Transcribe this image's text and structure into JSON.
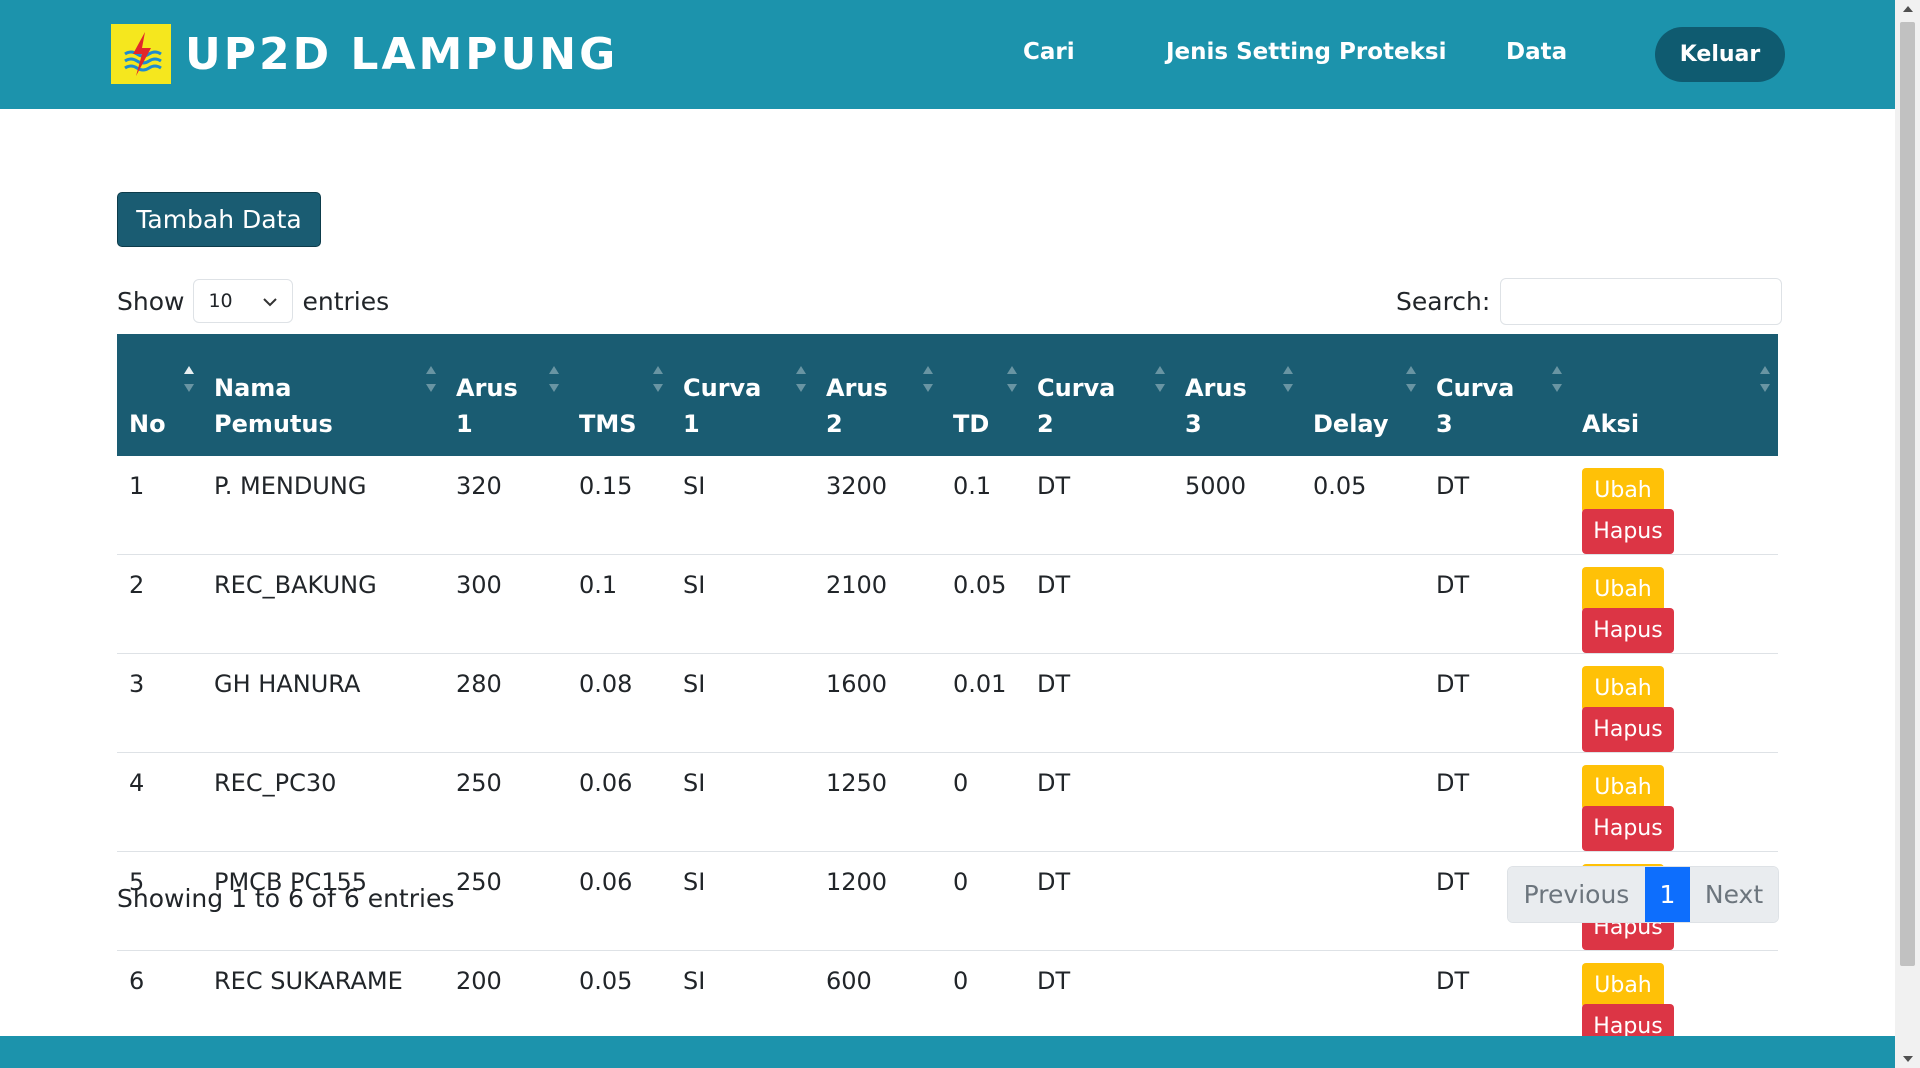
{
  "brand": {
    "name": "UP2D LAMPUNG",
    "logo_icon": "pln-logo-icon"
  },
  "nav": {
    "cari": "Cari",
    "jenis": "Jenis Setting Proteksi",
    "data": "Data",
    "logout": "Keluar"
  },
  "actions": {
    "add": "Tambah Data"
  },
  "length": {
    "show": "Show",
    "value": "10",
    "entries": "entries"
  },
  "search": {
    "label": "Search:",
    "value": ""
  },
  "table": {
    "headers": [
      [
        "No",
        ""
      ],
      [
        "Nama",
        "Pemutus"
      ],
      [
        "Arus",
        "1"
      ],
      [
        "",
        "TMS"
      ],
      [
        "",
        "Curva 1"
      ],
      [
        "Arus",
        "2"
      ],
      [
        "",
        "TD"
      ],
      [
        "Curva",
        "2"
      ],
      [
        "Arus",
        "3"
      ],
      [
        "",
        "Delay"
      ],
      [
        "Curva",
        "3"
      ],
      [
        "",
        "Aksi"
      ]
    ],
    "rows": [
      [
        "1",
        "P. MENDUNG",
        "320",
        "0.15",
        "SI",
        "3200",
        "0.1",
        "DT",
        "5000",
        "0.05",
        "DT"
      ],
      [
        "2",
        "REC_BAKUNG",
        "300",
        "0.1",
        "SI",
        "2100",
        "0.05",
        "DT",
        "",
        "",
        "DT"
      ],
      [
        "3",
        "GH HANURA",
        "280",
        "0.08",
        "SI",
        "1600",
        "0.01",
        "DT",
        "",
        "",
        "DT"
      ],
      [
        "4",
        "REC_PC30",
        "250",
        "0.06",
        "SI",
        "1250",
        "0",
        "DT",
        "",
        "",
        "DT"
      ],
      [
        "5",
        "PMCB PC155",
        "250",
        "0.06",
        "SI",
        "1200",
        "0",
        "DT",
        "",
        "",
        "DT"
      ],
      [
        "6",
        "REC SUKARAME",
        "200",
        "0.05",
        "SI",
        "600",
        "0",
        "DT",
        "",
        "",
        "DT"
      ]
    ],
    "edit_label": "Ubah",
    "delete_label": "Hapus"
  },
  "info": "Showing 1 to 6 of 6 entries",
  "pagination": {
    "previous": "Previous",
    "current": "1",
    "next": "Next"
  },
  "colors": {
    "navbar": "#1c93ac",
    "header": "#1a5c72",
    "edit": "#ffc107",
    "delete": "#dc3545",
    "page_active": "#0d6efd"
  }
}
